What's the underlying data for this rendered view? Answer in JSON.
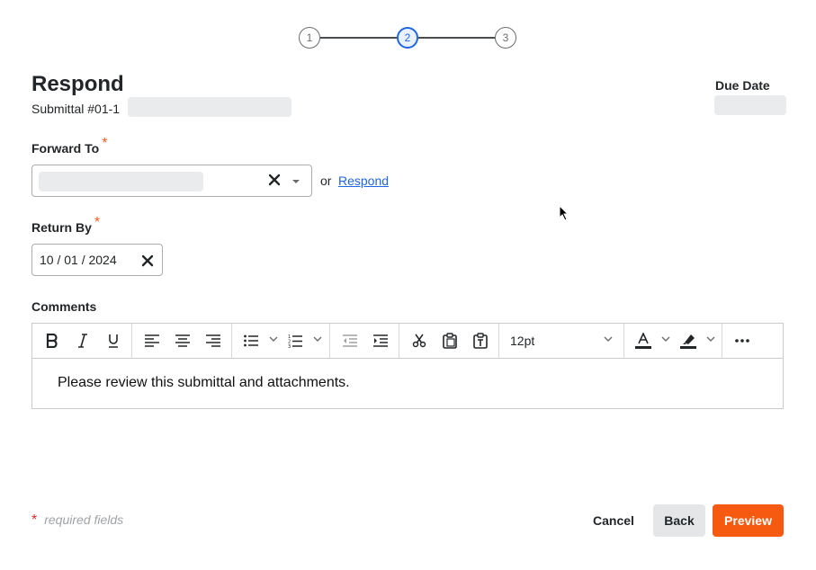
{
  "stepper": {
    "steps": [
      "1",
      "2",
      "3"
    ],
    "active": 2,
    "active_color": "#2066df"
  },
  "header": {
    "title": "Respond",
    "subtitle": "Submittal #01-1",
    "due_date_label": "Due Date"
  },
  "forward_to": {
    "label": "Forward To",
    "required_mark": "*",
    "or_text": "or",
    "respond_link": "Respond"
  },
  "return_by": {
    "label": "Return By",
    "required_mark": "*",
    "value": "10 / 01 / 2024"
  },
  "comments": {
    "label": "Comments",
    "font_size": "12pt",
    "body": "Please review this submittal and attachments.",
    "toolbar_icons": [
      "bold-icon",
      "italic-icon",
      "underline-icon",
      "align-left-icon",
      "align-center-icon",
      "align-right-icon",
      "bullet-list-icon",
      "numbered-list-icon",
      "outdent-icon",
      "indent-icon",
      "cut-icon",
      "paste-icon",
      "paste-text-icon",
      "font-color-icon",
      "highlight-icon",
      "more-icon"
    ]
  },
  "footer": {
    "required_star": "*",
    "required_note": "required fields",
    "cancel": "Cancel",
    "back": "Back",
    "preview": "Preview"
  },
  "colors": {
    "accent": "#f55a10",
    "required": "#f05d22",
    "link": "#2066df"
  }
}
